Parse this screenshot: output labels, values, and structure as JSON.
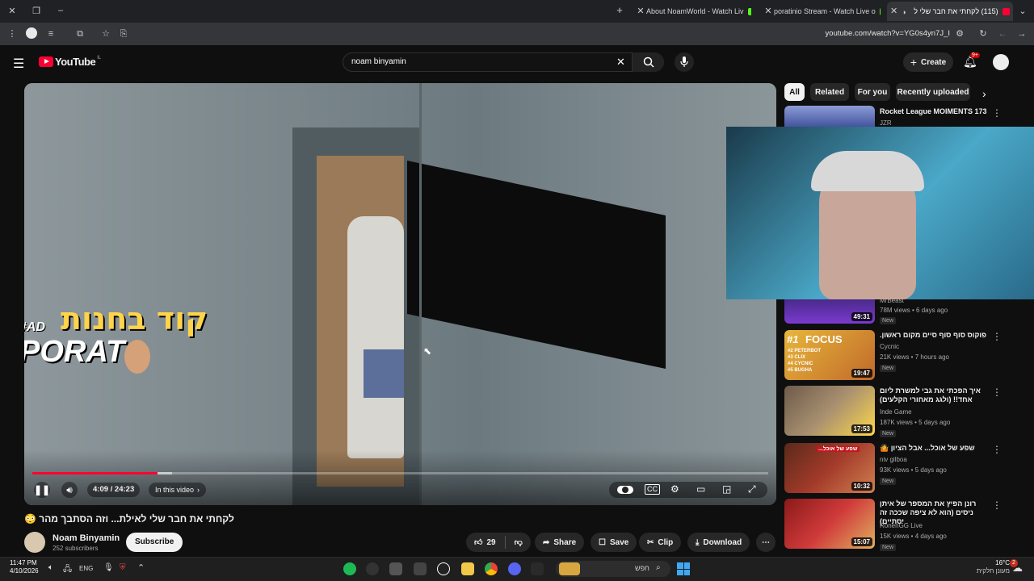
{
  "browser": {
    "tabs": [
      {
        "title": "About NoamWorld - Watch Liv",
        "favicon_color": "#53fc18"
      },
      {
        "title": "poratinio Stream - Watch Live o",
        "favicon_color": "#53fc18"
      },
      {
        "title": "(115) לקחתי את חבר שלי ל",
        "favicon_color": "#ff0033"
      }
    ],
    "url": "youtube.com/watch?v=YG0s4yn7J_I"
  },
  "youtube": {
    "logo_text": "YouTube",
    "logo_country": "IL",
    "search_value": "noam binyamin",
    "create_label": "Create",
    "notif_badge": "9+",
    "chips": [
      "All",
      "Related",
      "For you",
      "Recently uploaded"
    ]
  },
  "player": {
    "overlay_text_hebrew": "קוד בחנות",
    "overlay_text_brand": "PORAT",
    "overlay_text_ad": "#AD",
    "time": "4:09 / 24:23",
    "chapter": "In this video",
    "progress": 0.17,
    "buffered": 0.19
  },
  "video": {
    "title": "לקחתי את חבר שלי לאילת... וזה הסתבך מהר 😳",
    "channel": "Noam Binyamin",
    "subscribers": "252 subscribers",
    "subscribe_label": "Subscribe",
    "likes": "29",
    "share_label": "Share",
    "save_label": "Save",
    "clip_label": "Clip",
    "download_label": "Download"
  },
  "recommendations": [
    {
      "title": "Rocket League MOIMENTS 173",
      "channel": "JZR",
      "meta": "",
      "duration": "",
      "badge": ""
    },
    {
      "title": "",
      "channel": "MrBeast",
      "meta": "78M views • 6 days ago",
      "duration": "49:31",
      "badge": "New"
    },
    {
      "title": "פוקוס סוף סוף סיים מקום ראשון.",
      "channel": "Cycnic",
      "meta": "21K views • 7 hours ago",
      "duration": "19:47",
      "badge": "New"
    },
    {
      "title": "איך הפכתי את גבי למשרת ליום אחד!! (ולגג מאחורי הקלעים)",
      "channel": "Inde Game",
      "meta": "187K views • 5 days ago",
      "duration": "17:53",
      "badge": "New"
    },
    {
      "title": "שפע של אוכל... אבל הציון 🤷",
      "channel": "niv gilboa",
      "meta": "93K views • 5 days ago",
      "duration": "10:32",
      "badge": "New"
    },
    {
      "title": "רונן הפיץ את המספר של איתן ניסים (הוא לא ציפה שככה זה יסתיים)",
      "channel": "RonenGG Live",
      "meta": "15K views • 4 days ago",
      "duration": "15:07",
      "badge": "New"
    }
  ],
  "thumb_text": {
    "focus": "FOCUS",
    "focus_rank": "#1",
    "focus_list": [
      "#2 PETERBOT",
      "#3 CLIX",
      "#4 CYCNIC",
      "#5 BUGHA"
    ],
    "food": "שפע של אוכל..."
  },
  "taskbar": {
    "time": "11:47 PM",
    "date": "4/10/2026",
    "lang": "ENG",
    "search_placeholder": "חפש",
    "weather_temp": "16°C",
    "weather_desc": "מעונן חלקית",
    "weather_badge": "2"
  },
  "colors": {
    "accent_red": "#ff0033",
    "kick_green": "#53fc18",
    "bg": "#0f0f0f"
  }
}
